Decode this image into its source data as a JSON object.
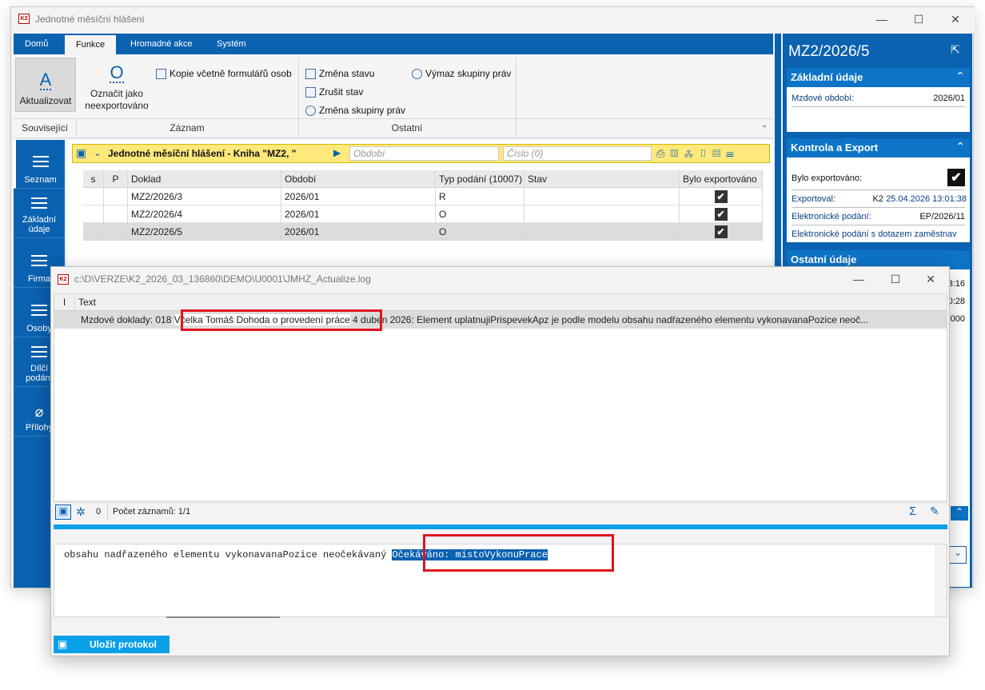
{
  "main_window": {
    "title": "Jednotné měsíční hlášení"
  },
  "ribbon": {
    "tabs": [
      "Domů",
      "Funkce",
      "Hromadné akce",
      "Systém"
    ],
    "aktualizovat": "Aktualizovat",
    "oznacit_line1": "Označit jako",
    "oznacit_line2": "neexportováno",
    "kopie": "Kopie včetně formulářů osob",
    "zmena_stavu": "Změna stavu",
    "zrusit_stav": "Zrušit stav",
    "zmena_skupiny": "Změna skupiny práv",
    "vymaz_skupiny": "Výmaz skupiny práv",
    "group_souvisejici": "Související",
    "group_zaznam": "Záznam",
    "group_ostatni": "Ostatní"
  },
  "sidebar": {
    "items": [
      {
        "label1": "Seznam",
        "label2": ""
      },
      {
        "label1": "Základní",
        "label2": "údaje"
      },
      {
        "label1": "Firma",
        "label2": ""
      },
      {
        "label1": "Osoby",
        "label2": ""
      },
      {
        "label1": "Dílčí",
        "label2": "podání"
      },
      {
        "label1": "Přílohy",
        "label2": ""
      }
    ]
  },
  "grid": {
    "title": "Jednotné měsíční hlášení - Kniha \"MZ2, \"",
    "obdobi_placeholder": "Období",
    "cislo_placeholder": "Číslo (0)",
    "columns": [
      "s",
      "P",
      "Doklad",
      "Období",
      "Typ podání (10007)",
      "Stav",
      "Bylo exportováno"
    ],
    "rows": [
      {
        "doklad": "MZ2/2026/3",
        "obdobi": "2026/01",
        "typ": "R",
        "stav": "",
        "export": "✔"
      },
      {
        "doklad": "MZ2/2026/4",
        "obdobi": "2026/01",
        "typ": "O",
        "stav": "",
        "export": "✔"
      },
      {
        "doklad": "MZ2/2026/5",
        "obdobi": "2026/01",
        "typ": "O",
        "stav": "",
        "export": "✔"
      }
    ]
  },
  "right_panel": {
    "doc_title": "MZ2/2026/5",
    "sec1": "Základní údaje",
    "mzdove_obdobi_label": "Mzdové období:",
    "mzdove_obdobi_value": "2026/01",
    "sec2": "Kontrola a Export",
    "bylo_exportovano_label": "Bylo exportováno:",
    "exportoval_label": "Exportoval:",
    "exportoval_user": "K2",
    "exportoval_date": "25.04.2026 13:01:38",
    "elpodani_label": "Elektronické podání:",
    "elpodani_value": "EP/2026/11",
    "elpodani_dotaz_label": "Elektronické podání s dotazem zaměstnav",
    "sec3": "Ostatní údaje",
    "peek1": "3:16",
    "peek2": "0:28",
    "peek3": "000"
  },
  "log_window": {
    "title": "c:\\D\\VERZE\\K2_2026_03_136860\\DEMO\\U0001\\JMHZ_Actualize.log",
    "col_i": "I",
    "col_text": "Text",
    "row_pre": "Mzdové doklady: 018",
    "row_highlight": "Včelka Tomáš Dohoda o provedení práce",
    "row_post": "4 duben 2026: Element uplatnujiPrispevekApz je podle modelu obsahu nadřazeného elementu vykonavanaPozice neoč...",
    "count_zero": "0",
    "pocet": "Počet záznamů: 1/1",
    "detail_text": "obsahu nadřazeného elementu vykonavanaPozice neočekávaný",
    "detail_selected": "Očekáváno: mistoVykonuPrace",
    "save_label": "Uložit protokol"
  },
  "colors": {
    "accent": "#0a62b0",
    "highlight": "#e0141e",
    "row_selected": "#dcdcdc",
    "grid_header_bar": "#ffe97a"
  }
}
